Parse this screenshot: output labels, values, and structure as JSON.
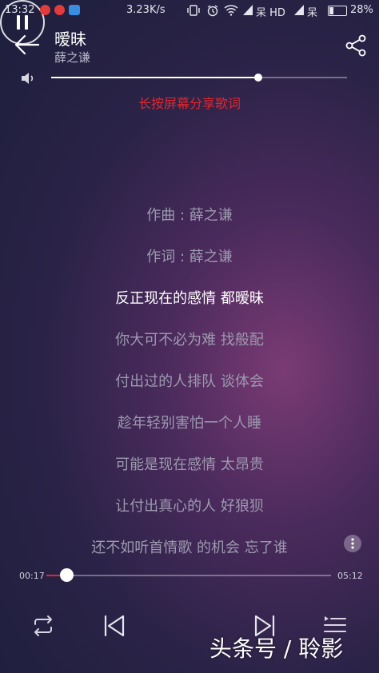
{
  "status_bar": {
    "time": "13:32",
    "speed": "3.23K/s",
    "carrier1": "呆 HD",
    "carrier2": "呆",
    "battery": "28%",
    "battery_level": 0.28,
    "icons": [
      "netease-music-icon",
      "netease-music-icon",
      "cloud-icon",
      "vibrate-icon",
      "alarm-icon",
      "wifi-icon",
      "signal-icon",
      "signal-icon",
      "battery-icon"
    ]
  },
  "header": {
    "title": "暧昧",
    "artist": "薛之谦"
  },
  "volume": {
    "level": 0.7
  },
  "share_hint": "长按屏幕分享歌词",
  "lyrics": [
    {
      "text": "作曲 : 薛之谦",
      "active": false
    },
    {
      "text": "作词 : 薛之谦",
      "active": false
    },
    {
      "text": "反正现在的感情 都暧昧",
      "active": true
    },
    {
      "text": "你大可不必为难 找般配",
      "active": false
    },
    {
      "text": "付出过的人排队 谈体会",
      "active": false
    },
    {
      "text": "趁年轻别害怕一个人睡",
      "active": false
    },
    {
      "text": "可能是现在感情 太昂贵",
      "active": false
    },
    {
      "text": "让付出真心的人 好狼狈",
      "active": false
    },
    {
      "text": "还不如听首情歌 的机会 忘了谁",
      "active": false
    }
  ],
  "progress": {
    "current": "00:17",
    "total": "05:12",
    "fraction": 0.07
  },
  "colors": {
    "accent": "#e0262e"
  },
  "watermark": "头条号 / 聆影"
}
